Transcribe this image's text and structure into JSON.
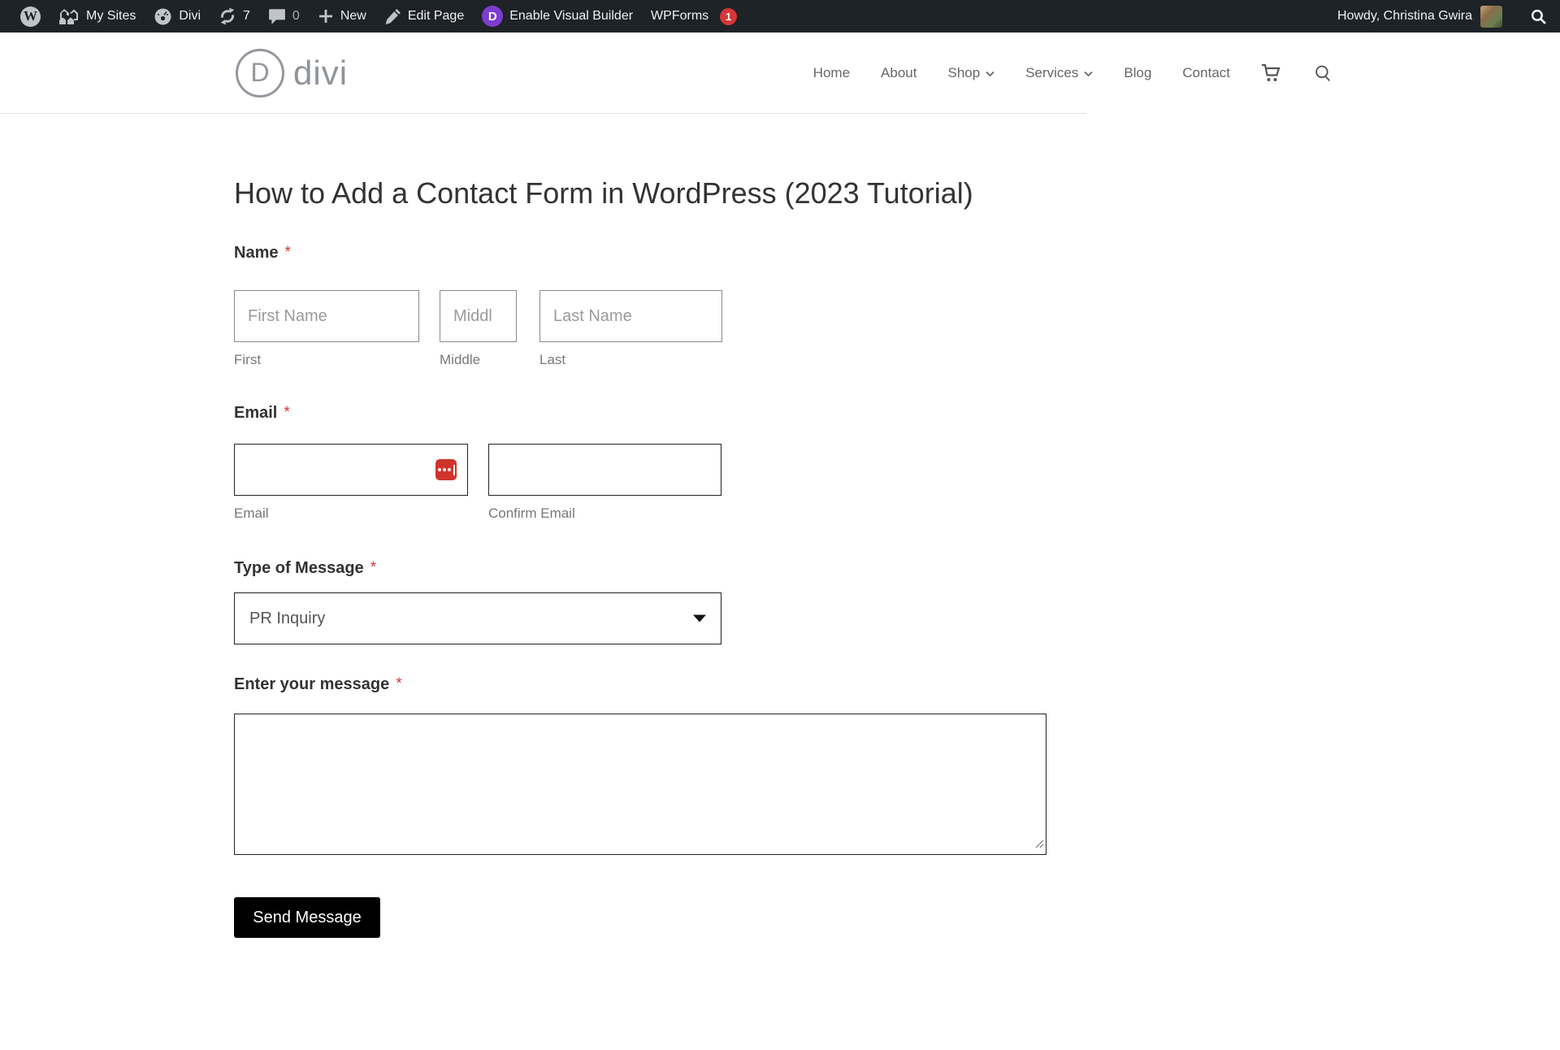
{
  "admin_bar": {
    "wp_logo_letter": "W",
    "my_sites": "My Sites",
    "divi": "Divi",
    "updates_count": "7",
    "comments_count": "0",
    "new_label": "New",
    "edit_page": "Edit Page",
    "enable_visual_builder": "Enable Visual Builder",
    "visual_builder_initial": "D",
    "wpforms": "WPForms",
    "wpforms_badge": "1",
    "howdy": "Howdy, Christina Gwira"
  },
  "header": {
    "logo_initial": "D",
    "logo_text": "divi",
    "nav": {
      "home": "Home",
      "about": "About",
      "shop": "Shop",
      "services": "Services",
      "blog": "Blog",
      "contact": "Contact"
    }
  },
  "page": {
    "title": "How to Add a Contact Form in WordPress (2023 Tutorial)"
  },
  "form": {
    "required_mark": "*",
    "name": {
      "label": "Name",
      "first_placeholder": "First Name",
      "middle_placeholder": "Middl",
      "last_placeholder": "Last Name",
      "first_sublabel": "First",
      "middle_sublabel": "Middle",
      "last_sublabel": "Last"
    },
    "email": {
      "label": "Email",
      "sublabel": "Email",
      "confirm_sublabel": "Confirm Email"
    },
    "type": {
      "label": "Type of Message",
      "selected": "PR Inquiry"
    },
    "message": {
      "label": "Enter your message"
    },
    "submit_label": "Send Message"
  },
  "colors": {
    "admin_bar_bg": "#1d2327",
    "required_red": "#d63638",
    "builder_purple": "#7e3bd0",
    "lastpass_red": "#d0342c",
    "button_black": "#000000"
  }
}
